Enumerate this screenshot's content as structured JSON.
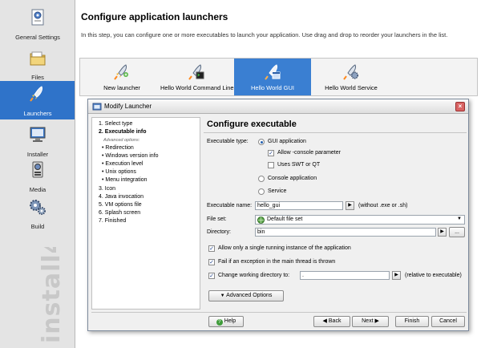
{
  "sidebar": {
    "items": [
      {
        "label": "General Settings",
        "icon": "settings-document-icon"
      },
      {
        "label": "Files",
        "icon": "folder-icon"
      },
      {
        "label": "Launchers",
        "icon": "rocket-icon"
      },
      {
        "label": "Installer",
        "icon": "monitor-icon"
      },
      {
        "label": "Media",
        "icon": "media-drive-icon"
      },
      {
        "label": "Build",
        "icon": "gears-icon"
      }
    ],
    "active_index": 2,
    "watermark": "install4j"
  },
  "main": {
    "title": "Configure application launchers",
    "description": "In this step, you can configure one or more executables to launch your application. Use drag and drop to reorder your launchers in the list."
  },
  "launchers": {
    "items": [
      {
        "label": "New launcher"
      },
      {
        "label": "Hello World Command Line"
      },
      {
        "label": "Hello World GUI"
      },
      {
        "label": "Hello World Service"
      }
    ],
    "selected": "Hello World GUI"
  },
  "dialog": {
    "title": "Modify Launcher",
    "steps": {
      "s1": "1. Select type",
      "s2": "2. Executable info",
      "adv": "Advanced options:",
      "sub": [
        "• Redirection",
        "• Windows version info",
        "• Execution level",
        "• Unix options",
        "• Menu integration"
      ],
      "rest": [
        "3. Icon",
        "4. Java invocation",
        "5. VM options file",
        "6. Splash screen",
        "7. Finished"
      ]
    },
    "heading": "Configure executable",
    "executable_type_label": "Executable type:",
    "gui_app": "GUI application",
    "allow_console": "Allow -console parameter",
    "uses_swt": "Uses SWT or QT",
    "console_app": "Console application",
    "service": "Service",
    "exe_name_label": "Executable name:",
    "exe_name_value": "hello_gui",
    "exe_name_hint": "(without .exe or .sh)",
    "fileset_label": "File set:",
    "fileset_value": "Default file set",
    "directory_label": "Directory:",
    "directory_value": "bin",
    "browse": "...",
    "single_instance": "Allow only a single running instance of the application",
    "fail_exception": "Fail if an exception in the main thread is thrown",
    "change_dir": "Change working directory to:",
    "change_dir_value": ".",
    "relative_hint": "(relative to executable)",
    "advanced_options": "Advanced Options",
    "help": "Help",
    "back": "Back",
    "next": "Next",
    "finish": "Finish",
    "cancel": "Cancel"
  }
}
